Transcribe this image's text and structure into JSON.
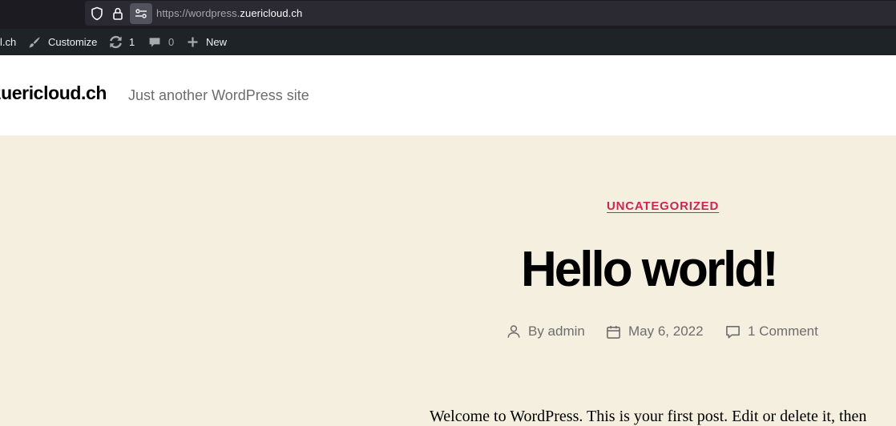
{
  "browser": {
    "url_scheme": "https://wordpress.",
    "url_domain": "zuericloud.ch"
  },
  "admin_bar": {
    "site_label": "l.ch",
    "customize_label": "Customize",
    "updates_count": "1",
    "comments_count": "0",
    "new_label": "New"
  },
  "header": {
    "site_title": "zuericloud.ch",
    "tagline": "Just another WordPress site"
  },
  "post": {
    "category": "UNCATEGORIZED",
    "title": "Hello world!",
    "author": "By admin",
    "date": "May 6, 2022",
    "comments": "1 Comment",
    "excerpt": "Welcome to WordPress. This is your first post. Edit or delete it, then"
  },
  "colors": {
    "accent": "#cd2653",
    "background": "#f5efe0",
    "admin_bar": "#1d2327"
  }
}
